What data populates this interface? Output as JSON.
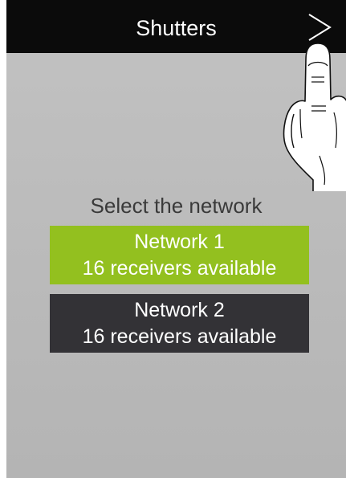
{
  "header": {
    "title": "Shutters",
    "next_icon": "chevron-right-icon"
  },
  "gesture_hint": {
    "icon": "tapping-hand-icon"
  },
  "main": {
    "prompt": "Select the network",
    "networks": [
      {
        "name": "Network 1",
        "status": "16 receivers available",
        "color": "#93c01f",
        "selected": true
      },
      {
        "name": "Network 2",
        "status": "16 receivers available",
        "color": "#333236",
        "selected": false
      }
    ]
  },
  "colors": {
    "header_bg": "#0b0b0b",
    "screen_bg": "#bcbcbc",
    "accent": "#93c01f",
    "secondary": "#333236"
  }
}
